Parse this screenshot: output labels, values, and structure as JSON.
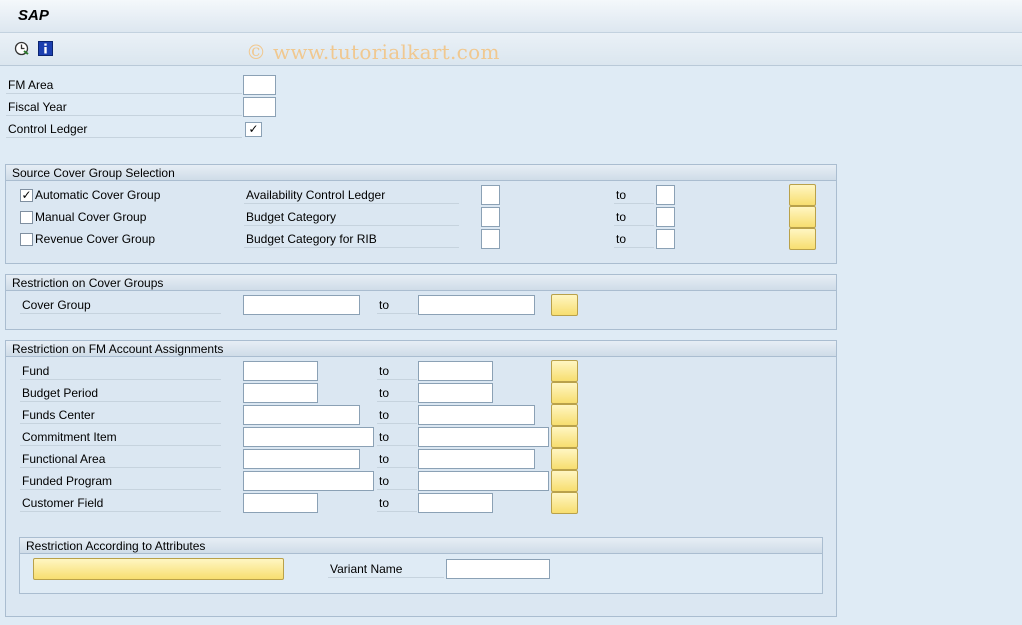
{
  "app": {
    "title": "SAP"
  },
  "toolbar": {
    "watermark": "© www.tutorialkart.com",
    "execute_icon": "execute-clock-icon",
    "info_icon": "info-icon"
  },
  "params": {
    "fm_area": "FM Area",
    "fiscal_year": "Fiscal Year",
    "control_ledger": "Control Ledger",
    "control_ledger_checked": true
  },
  "source": {
    "title": "Source Cover Group Selection",
    "rows": [
      {
        "check": "Automatic Cover Group",
        "checked": true,
        "field": "Availability Control Ledger",
        "to": "to"
      },
      {
        "check": "Manual Cover Group",
        "checked": false,
        "field": "Budget Category",
        "to": "to"
      },
      {
        "check": "Revenue Cover Group",
        "checked": false,
        "field": "Budget Category for RIB",
        "to": "to"
      }
    ]
  },
  "cover": {
    "title": "Restriction on Cover Groups",
    "label": "Cover Group",
    "to": "to"
  },
  "fm": {
    "title": "Restriction on FM Account Assignments",
    "rows": [
      {
        "label": "Fund",
        "to": "to"
      },
      {
        "label": "Budget Period",
        "to": "to"
      },
      {
        "label": "Funds Center",
        "to": "to"
      },
      {
        "label": "Commitment Item",
        "to": "to"
      },
      {
        "label": "Functional Area",
        "to": "to"
      },
      {
        "label": "Funded Program",
        "to": "to"
      },
      {
        "label": "Customer Field",
        "to": "to"
      }
    ]
  },
  "attr": {
    "title": "Restriction According to Attributes",
    "variant_label": "Variant Name"
  }
}
